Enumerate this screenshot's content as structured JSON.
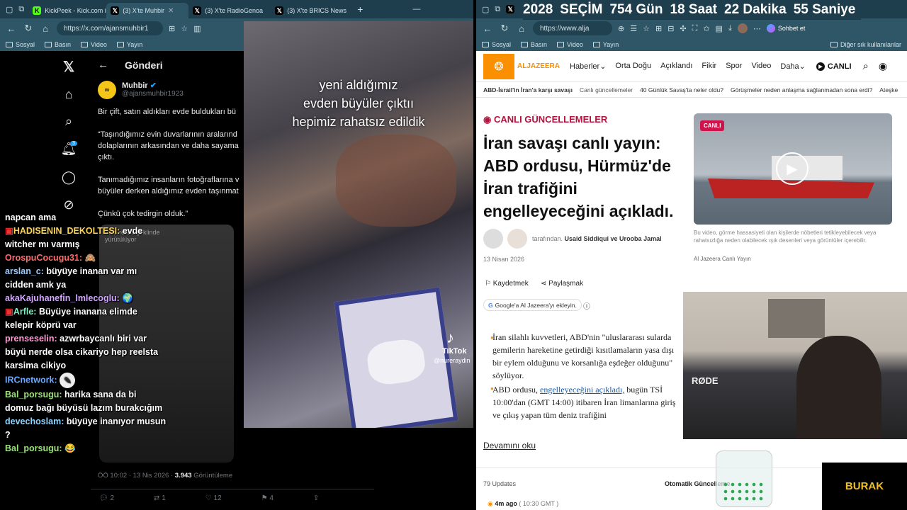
{
  "left_browser": {
    "tabs": [
      {
        "icon": "kick",
        "label": "KickPeek - Kick.com iç"
      },
      {
        "icon": "x",
        "label": "(3) X'te Muhbir"
      },
      {
        "icon": "x",
        "label": "(3) X'te RadioGenoa"
      },
      {
        "icon": "x",
        "label": "(3) X'te BRICS News"
      }
    ],
    "url": "https://x.com/ajansmuhbir1",
    "bookmarks": [
      "Sosyal",
      "Basın",
      "Video",
      "Yayın"
    ]
  },
  "right_browser": {
    "countdown": [
      "2028",
      "SEÇİM",
      "754 Gün",
      "18 Saat",
      "22 Dakika",
      "55 Saniye"
    ],
    "url": "https://www.alja",
    "bookmarks": [
      "Sosyal",
      "Basın",
      "Video",
      "Yayın"
    ],
    "bookmarks_right": "Diğer sık kullanılanlar",
    "copilot": "Sohbet et"
  },
  "x": {
    "header": "Gönderi",
    "notif_count": "3",
    "author": {
      "name": "Muhbir",
      "handle": "@ajansmuhbir1923",
      "avatar": "muhbir"
    },
    "paragraphs": [
      "Bir çift, satın aldıkları evde buldukları bü",
      "“Taşındığımız evin duvarlarının aralarınd dolaplarının arkasından ve daha sayama çıktı.",
      "Tanımadığımız insanların fotoğraflarına v büyüler derken aldığımız evden taşınmat",
      "Çünkü çok tedirgin olduk.”"
    ],
    "media_caption": "ında resim şeklinde yürütülüyor",
    "meta": {
      "time": "ÖÖ 10:02 · 13 Nis 2026 · ",
      "views": "3.943",
      "views_label": " Görüntüleme"
    },
    "actions": {
      "replies": "2",
      "retweets": "1",
      "likes": "12",
      "bookmarks": "4"
    }
  },
  "video": {
    "lines": [
      "yeni aldığımız",
      "evden büyüler çıktıı",
      "hepimiz rahatsız edildik"
    ],
    "tiktok": "TikTok",
    "tiktok_user": "@nureraydin"
  },
  "chat": [
    {
      "user": "",
      "color": "#fff",
      "text": "napcan ama"
    },
    {
      "user": "HADISENIN_DEKOLTESI:",
      "color": "#ffd54f",
      "text": " evde witcher mı varmış",
      "badge": true
    },
    {
      "user": "OrospuCocugu31:",
      "color": "#ff6b6b",
      "text": " 🙈"
    },
    {
      "user": "arslan_c:",
      "color": "#9ecbff",
      "text": " büyüye inanan var mı cidden amk ya"
    },
    {
      "user": "akaKajuhanefi̇n_lmlecoglu:",
      "color": "#d2a6ff",
      "text": " 🌍"
    },
    {
      "user": "Arfle:",
      "color": "#7cf0c0",
      "text": " Büyüye inanana elimde kelepir köprü var",
      "badge": true
    },
    {
      "user": "prenseselin:",
      "color": "#ff9ad5",
      "text": " azwrbaycanlı biri var büyü nerde olsa cikariyo hep reelsta karsima cikiyo"
    },
    {
      "user": "IRCnetwork:",
      "color": "#6fa8ff",
      "text": " "
    },
    {
      "user": "Bal_porsugu:",
      "color": "#9be37a",
      "text": " harika sana da bi domuz bağı büyüsü lazım burakcığım"
    },
    {
      "user": "devechoslam:",
      "color": "#8fd3ff",
      "text": " büyüye inanıyor musun ?"
    },
    {
      "user": "Bal_porsugu:",
      "color": "#9be37a",
      "text": " 😂"
    }
  ],
  "aj": {
    "logo": "ALJAZEERA",
    "nav": [
      "Haberler",
      "Orta Doğu",
      "Açıklandı",
      "Fikir",
      "Spor",
      "Video",
      "Daha"
    ],
    "live_btn": "CANLI",
    "subnav": [
      "ABD-İsrail'in İran'a karşı savaşı",
      "Canlı güncellemeler",
      "40 Günlük Savaş'ta neler oldu?",
      "Görüşmeler neden anlaşma sağlanmadan sona erdi?",
      "Ateşke"
    ],
    "live_label": "CANLI GÜNCELLEMELER",
    "headline": "İran savaşı canlı yayın: ABD ordusu, Hürmüz'de İran trafiğini engelleyeceğini açıkladı.",
    "byline_prefix": "tarafından.",
    "authors": "Usaid Siddiqui ve Urooba Jamal",
    "date": "13 Nisan 2026",
    "save": "Kaydetmek",
    "share": "Paylaşmak",
    "google": "Google'a Al Jazeera'yı ekleyin.",
    "video_badge": "CANLI",
    "video_caption": "Bu video, görme hassasiyeti olan kişilerde nöbetleri tetikleyebilecek veya rahatsızlığa neden olabilecek ışık desenleri veya görüntüler içerebilir.",
    "video_source": "Al Jazeera Canlı Yayın",
    "bullet1": "İran silahlı kuvvetleri, ABD'nin \"uluslararası sularda gemilerin hareketine getirdiği kısıtlamaların yasa dışı bir eylem olduğunu ve korsanlığa eşdeğer olduğunu\" söylüyor.",
    "bullet2_a": "ABD ordusu, ",
    "bullet2_link": "engelleyeceğini açıkladı,",
    "bullet2_b": " bugün TSİ 10:00'dan (GMT 14:00) itibaren İran limanlarına giriş ve çıkış yapan tüm deniz trafiğini",
    "read_more": "Devamını oku",
    "updates": "79 Updates",
    "auto_update": "Otomatik Güncelleme",
    "last": "4m ago",
    "last_time": "( 10:30 GMT )"
  },
  "stream": {
    "name": "BURAK",
    "mic": "RØDE"
  }
}
